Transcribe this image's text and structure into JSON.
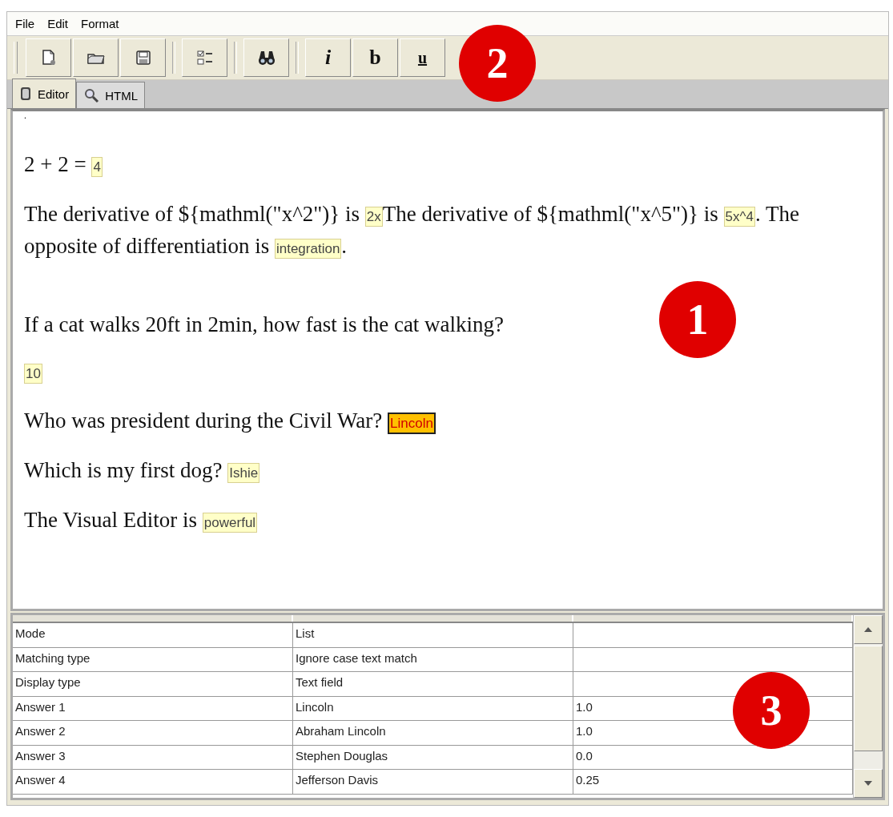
{
  "menu": [
    {
      "label": "File"
    },
    {
      "label": "Edit"
    },
    {
      "label": "Format"
    }
  ],
  "toolbar": [
    {
      "kind": "new"
    },
    {
      "kind": "open"
    },
    {
      "kind": "save"
    },
    {
      "kind": "separator"
    },
    {
      "kind": "list"
    },
    {
      "kind": "separator"
    },
    {
      "kind": "find"
    },
    {
      "kind": "separator"
    },
    {
      "kind": "italic",
      "label": "i"
    },
    {
      "kind": "bold",
      "label": "b"
    },
    {
      "kind": "underline",
      "label": "u"
    }
  ],
  "tabs": [
    {
      "label": "Editor",
      "kind": "book",
      "selected": true
    },
    {
      "label": "HTML",
      "kind": "magnifier",
      "selected": false
    }
  ],
  "editor": {
    "caret": ".",
    "paragraphs": [
      {
        "parts": [
          {
            "text": "2 + 2 = "
          },
          {
            "answer": "4",
            "selected": false
          }
        ]
      },
      {
        "parts": [
          {
            "text": "The derivative of ${mathml(\"x^2\")} is "
          },
          {
            "answer": "2x",
            "selected": false
          },
          {
            "text": "The derivative of ${mathml(\"x^5\")} is "
          },
          {
            "answer": "5x^4",
            "selected": false
          },
          {
            "text": ". The opposite of differentiation is "
          },
          {
            "answer": "integration",
            "selected": false
          },
          {
            "text": "."
          }
        ]
      },
      {
        "parts": [
          {
            "text": "If a cat walks 20ft in 2min, how fast is the cat walking?"
          }
        ]
      },
      {
        "parts": [
          {
            "answer": "10",
            "selected": false
          }
        ]
      },
      {
        "parts": [
          {
            "text": "Who was president during the Civil War? "
          },
          {
            "answer": "Lincoln",
            "selected": true
          }
        ]
      },
      {
        "parts": [
          {
            "text": "Which is my first dog? "
          },
          {
            "answer": "Ishie",
            "selected": false
          }
        ]
      },
      {
        "parts": [
          {
            "text": "The Visual Editor is "
          },
          {
            "answer": "powerful",
            "selected": false
          }
        ]
      }
    ]
  },
  "table": {
    "rows": [
      {
        "cells": [
          "Mode",
          "List"
        ]
      },
      {
        "cells": [
          "Matching type",
          "Ignore case text match"
        ]
      },
      {
        "cells": [
          "Display type",
          "Text field"
        ]
      },
      {
        "cells": [
          "Answer 1",
          "Lincoln",
          "1.0"
        ]
      },
      {
        "cells": [
          "Answer 2",
          "Abraham Lincoln",
          "1.0"
        ]
      },
      {
        "cells": [
          "Answer 3",
          "Stephen Douglas",
          "0.0"
        ]
      },
      {
        "cells": [
          "Answer 4",
          "Jefferson Davis",
          "0.25"
        ]
      }
    ]
  },
  "callouts": [
    {
      "label": "2"
    },
    {
      "label": "1"
    },
    {
      "label": "3"
    }
  ]
}
